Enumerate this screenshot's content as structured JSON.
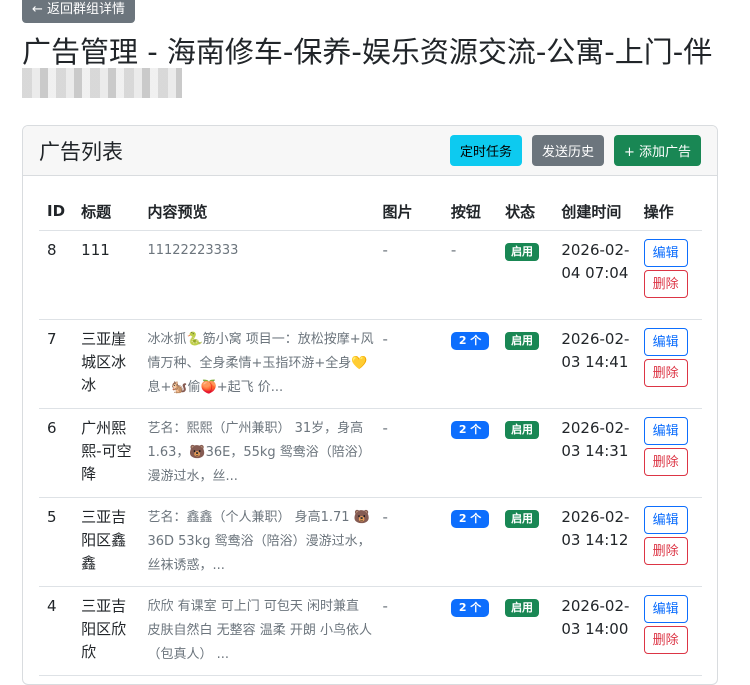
{
  "back_label": "← 返回群组详情",
  "page_title": "广告管理 - 海南修车-保养-娱乐资源交流-公寓-上门-伴",
  "card": {
    "title": "广告列表",
    "btn_scheduled": "定时任务",
    "btn_history": "发送历史",
    "btn_add": "+ 添加广告"
  },
  "columns": [
    "ID",
    "标题",
    "内容预览",
    "图片",
    "按钮",
    "状态",
    "创建时间",
    "操作"
  ],
  "rows": [
    {
      "id": "8",
      "title": "111",
      "content": "11122223333",
      "image": "-",
      "buttons": "-",
      "buttons_is_badge": false,
      "status": "启用",
      "time": "2026-02-04 07:04",
      "edit": "编辑",
      "delete": "删除"
    },
    {
      "id": "7",
      "title": "三亚崖城区冰冰",
      "content": "冰冰抓🐍筋小窝 项目一：放松按摩+风情万种、全身柔情+玉指环游+全身💛息+🐿️偷🍑+起飞 价...",
      "image": "-",
      "buttons": "2 个",
      "buttons_is_badge": true,
      "status": "启用",
      "time": "2026-02-03 14:41",
      "edit": "编辑",
      "delete": "删除"
    },
    {
      "id": "6",
      "title": "广州熙熙-可空降",
      "content": "艺名：熙熙（广州兼职） 31岁，身高1.63，🐻36E，55kg 鸳鸯浴（陪浴）漫游过水，丝...",
      "image": "-",
      "buttons": "2 个",
      "buttons_is_badge": true,
      "status": "启用",
      "time": "2026-02-03 14:31",
      "edit": "编辑",
      "delete": "删除"
    },
    {
      "id": "5",
      "title": "三亚吉阳区鑫鑫",
      "content": "艺名：鑫鑫（个人兼职） 身高1.71 🐻36D 53kg 鸳鸯浴（陪浴）漫游过水，丝袜诱惑，...",
      "image": "-",
      "buttons": "2 个",
      "buttons_is_badge": true,
      "status": "启用",
      "time": "2026-02-03 14:12",
      "edit": "编辑",
      "delete": "删除"
    },
    {
      "id": "4",
      "title": "三亚吉阳区欣欣",
      "content": "欣欣 有课室 可上门 可包天 闲时兼直 皮肤自然白 无整容 温柔 开朗 小鸟依人（包真人） ...",
      "image": "-",
      "buttons": "2 个",
      "buttons_is_badge": true,
      "status": "启用",
      "time": "2026-02-03 14:00",
      "edit": "编辑",
      "delete": "删除"
    }
  ]
}
